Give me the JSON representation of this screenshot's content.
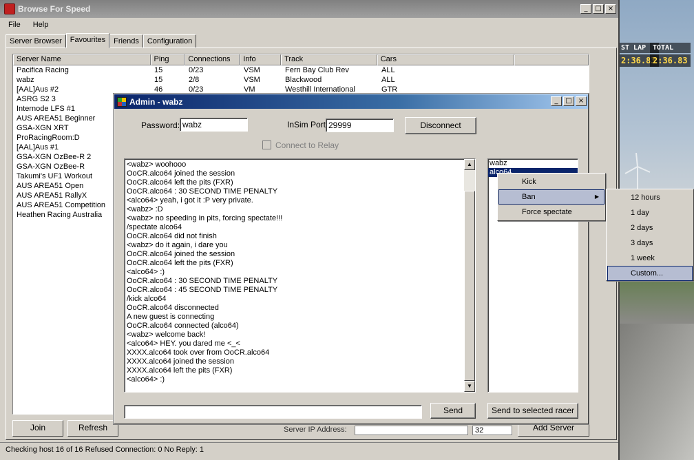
{
  "app": {
    "title": "Browse For Speed"
  },
  "window_controls": {
    "minimize": "_",
    "maximize": "□",
    "close": "×"
  },
  "menu": {
    "file": "File",
    "help": "Help"
  },
  "tabs": [
    "Server Browser",
    "Favourites",
    "Friends",
    "Configuration"
  ],
  "active_tab": "Favourites",
  "servers": {
    "columns": [
      "Server Name",
      "Ping",
      "Connections",
      "Info",
      "Track",
      "Cars"
    ],
    "rows": [
      [
        "Pacifica Racing",
        "15",
        "0/23",
        "VSM",
        "Fern Bay Club Rev",
        "ALL"
      ],
      [
        "wabz",
        "15",
        "2/8",
        "VSM",
        "Blackwood",
        "ALL"
      ],
      [
        "[AAL]Aus #2",
        "46",
        "0/23",
        "VM",
        "Westhill International",
        "GTR"
      ],
      [
        "ASRG S2 3",
        "",
        "",
        "",
        "",
        ""
      ],
      [
        "Internode LFS #1",
        "",
        "",
        "",
        "",
        ""
      ],
      [
        "AUS AREA51 Beginner",
        "",
        "",
        "",
        "",
        ""
      ],
      [
        "GSA-XGN XRT",
        "",
        "",
        "",
        "",
        ""
      ],
      [
        "ProRacingRoom:D",
        "",
        "",
        "",
        "",
        ""
      ],
      [
        "[AAL]Aus #1",
        "",
        "",
        "",
        "",
        ""
      ],
      [
        "GSA-XGN OzBee-R 2",
        "",
        "",
        "",
        "",
        ""
      ],
      [
        "GSA-XGN OzBee-R",
        "",
        "",
        "",
        "",
        ""
      ],
      [
        "Takumi's UF1 Workout",
        "",
        "",
        "",
        "",
        ""
      ],
      [
        "AUS AREA51 Open",
        "",
        "",
        "",
        "",
        ""
      ],
      [
        "AUS AREA51 RallyX",
        "",
        "",
        "",
        "",
        ""
      ],
      [
        "AUS AREA51 Competition",
        "",
        "",
        "",
        "",
        ""
      ],
      [
        "Heathen Racing Australia",
        "",
        "",
        "",
        "",
        ""
      ]
    ]
  },
  "buttons": {
    "join": "Join",
    "refresh": "Refresh",
    "add_server": "Add Server"
  },
  "behind_label": "Server IP Address:",
  "behind_port": "32",
  "status": "Checking host 16 of 16  Refused Connection: 0  No Reply: 1",
  "admin": {
    "title": "Admin - wabz",
    "password_label": "Password:",
    "password_value": "wabz",
    "insim_label": "InSim Port:",
    "insim_value": "29999",
    "disconnect": "Disconnect",
    "relay_label": "Connect to Relay",
    "log": [
      "<wabz> woohooo",
      "OoCR.alco64 joined the session",
      "OoCR.alco64 left the pits (FXR)",
      "OoCR.alco64 : 30 SECOND TIME PENALTY",
      "<alco64> yeah, i got it :P very private.",
      "<wabz> :D",
      "<wabz> no speeding in pits, forcing spectate!!!",
      "/spectate alco64",
      "OoCR.alco64 did not finish",
      "<wabz> do it again, i dare you",
      "OoCR.alco64 joined the session",
      "OoCR.alco64 left the pits (FXR)",
      "<alco64> :)",
      "OoCR.alco64 : 30 SECOND TIME PENALTY",
      "OoCR.alco64 : 45 SECOND TIME PENALTY",
      "/kick alco64",
      "OoCR.alco64 disconnected",
      "A new guest is connecting",
      "OoCR.alco64 connected (alco64)",
      "<wabz> welcome back!",
      "<alco64> HEY. you dared me <_<",
      "XXXX.alco64 took over from OoCR.alco64",
      "XXXX.alco64 joined the session",
      "XXXX.alco64 left the pits (FXR)",
      "<alco64> :)"
    ],
    "racers": [
      "wabz",
      "alco64"
    ],
    "send": "Send",
    "send_selected": "Send to selected racer"
  },
  "context_menu": {
    "items": [
      "Kick",
      "Ban",
      "Force spectate"
    ],
    "highlighted": "Ban",
    "ban_submenu": [
      "12 hours",
      "1 day",
      "2 days",
      "3 days",
      "1 week",
      "Custom..."
    ],
    "ban_highlighted": "Custom..."
  },
  "hud": {
    "last_lap_label": "ST LAP",
    "last_lap": "2:36.83",
    "total_label": "TOTAL",
    "total": "2:36.83"
  }
}
